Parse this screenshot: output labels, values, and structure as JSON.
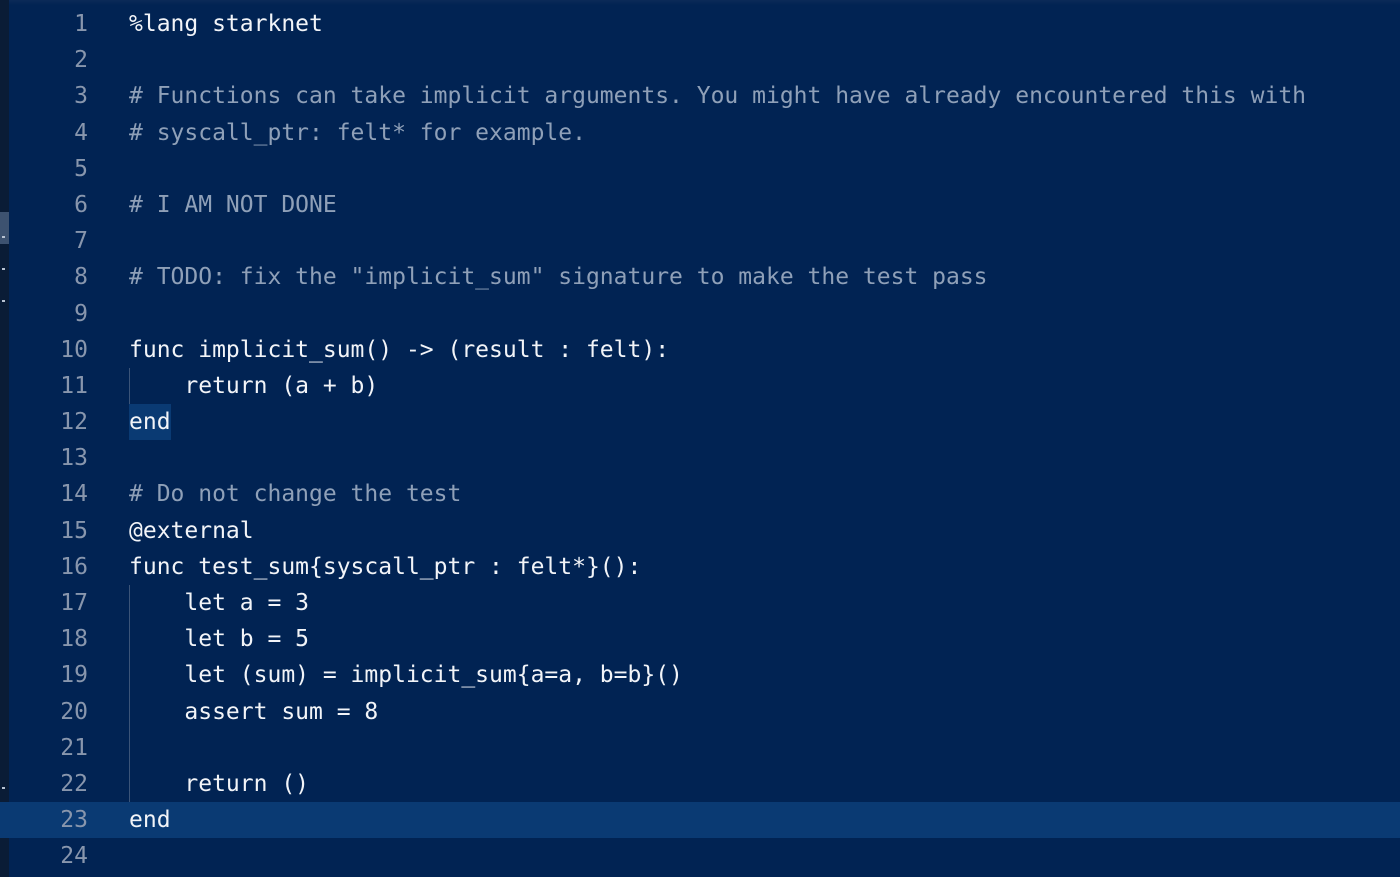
{
  "editor": {
    "lines": [
      {
        "num": "1",
        "text": "%lang starknet"
      },
      {
        "num": "2",
        "text": ""
      },
      {
        "num": "3",
        "text": "# Functions can take implicit arguments. You might have already encountered this with"
      },
      {
        "num": "4",
        "text": "# syscall_ptr: felt* for example."
      },
      {
        "num": "5",
        "text": ""
      },
      {
        "num": "6",
        "text": "# I AM NOT DONE"
      },
      {
        "num": "7",
        "text": ""
      },
      {
        "num": "8",
        "text": "# TODO: fix the \"implicit_sum\" signature to make the test pass"
      },
      {
        "num": "9",
        "text": ""
      },
      {
        "num": "10",
        "text": "func implicit_sum() -> (result : felt):"
      },
      {
        "num": "11",
        "text": "    return (a + b)"
      },
      {
        "num": "12",
        "text": "end"
      },
      {
        "num": "13",
        "text": ""
      },
      {
        "num": "14",
        "text": "# Do not change the test"
      },
      {
        "num": "15",
        "text": "@external"
      },
      {
        "num": "16",
        "text": "func test_sum{syscall_ptr : felt*}():"
      },
      {
        "num": "17",
        "text": "    let a = 3"
      },
      {
        "num": "18",
        "text": "    let b = 5"
      },
      {
        "num": "19",
        "text": "    let (sum) = implicit_sum{a=a, b=b}()"
      },
      {
        "num": "20",
        "text": "    assert sum = 8"
      },
      {
        "num": "21",
        "text": ""
      },
      {
        "num": "22",
        "text": "    return ()"
      },
      {
        "num": "23",
        "text": "end"
      },
      {
        "num": "24",
        "text": ""
      }
    ],
    "current_line": "23"
  },
  "colors": {
    "background": "#012353",
    "current_line": "#0a3a73",
    "line_number": "#8896ad",
    "comment": "#8fa0b8",
    "code": "#f2f4f8"
  }
}
